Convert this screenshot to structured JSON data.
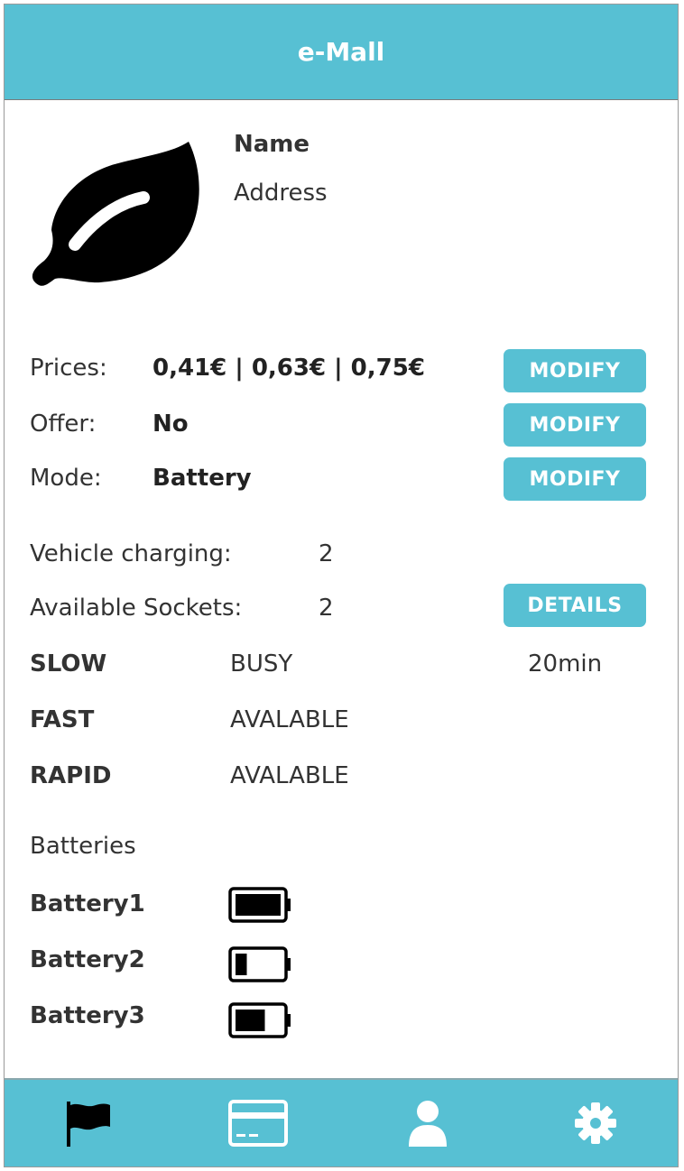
{
  "app": {
    "title": "e-Mall"
  },
  "station": {
    "name": "Name",
    "address": "Address",
    "logo_icon": "leaf-icon"
  },
  "settings": {
    "prices_label": "Prices:",
    "prices_value": "0,41€ | 0,63€ | 0,75€",
    "offer_label": "Offer:",
    "offer_value": "No",
    "mode_label": "Mode:",
    "mode_value": "Battery",
    "modify_label": "MODIFY"
  },
  "status": {
    "vehicle_charging_label": "Vehicle charging:",
    "vehicle_charging_value": "2",
    "available_sockets_label": "Available Sockets:",
    "available_sockets_value": "2",
    "details_label": "DETAILS"
  },
  "sockets": [
    {
      "type": "SLOW",
      "status": "BUSY",
      "time": "20min"
    },
    {
      "type": "FAST",
      "status": "AVALABLE",
      "time": ""
    },
    {
      "type": "RAPID",
      "status": "AVALABLE",
      "time": ""
    }
  ],
  "batteries": {
    "title": "Batteries",
    "items": [
      {
        "name": "Battery1",
        "level": 1.0
      },
      {
        "name": "Battery2",
        "level": 0.25
      },
      {
        "name": "Battery3",
        "level": 0.65
      }
    ]
  },
  "nav": [
    {
      "icon": "flag-icon"
    },
    {
      "icon": "credit-card-icon"
    },
    {
      "icon": "user-icon"
    },
    {
      "icon": "gear-icon"
    }
  ],
  "colors": {
    "accent": "#57c0d3",
    "accent_text": "#ffffff"
  }
}
